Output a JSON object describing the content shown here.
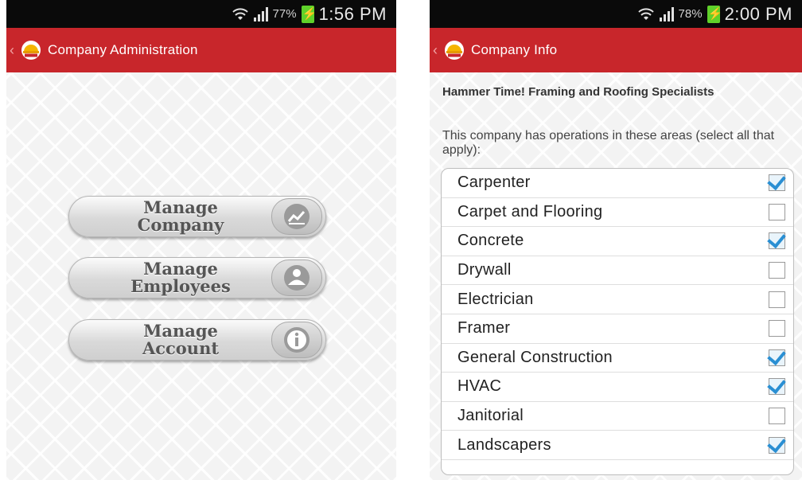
{
  "left": {
    "status": {
      "battery": "77%",
      "time": "1:56 PM"
    },
    "title": "Company Administration",
    "buttons": [
      {
        "line1": "Manage",
        "line2": "Company",
        "icon": "chart-icon"
      },
      {
        "line1": "Manage",
        "line2": "Employees",
        "icon": "people-icon"
      },
      {
        "line1": "Manage",
        "line2": "Account",
        "icon": "info-icon"
      }
    ]
  },
  "right": {
    "status": {
      "battery": "78%",
      "time": "2:00 PM"
    },
    "title": "Company Info",
    "company_name": "Hammer Time!  Framing and Roofing Specialists",
    "instructions": "This company has operations in these areas (select all that apply):",
    "items": [
      {
        "label": "Carpenter",
        "checked": true
      },
      {
        "label": "Carpet and Flooring",
        "checked": false
      },
      {
        "label": "Concrete",
        "checked": true
      },
      {
        "label": "Drywall",
        "checked": false
      },
      {
        "label": "Electrician",
        "checked": false
      },
      {
        "label": "Framer",
        "checked": false
      },
      {
        "label": "General Construction",
        "checked": true
      },
      {
        "label": "HVAC",
        "checked": true
      },
      {
        "label": "Janitorial",
        "checked": false
      },
      {
        "label": "Landscapers",
        "checked": true
      }
    ]
  },
  "colors": {
    "actionbar": "#c8262b",
    "checkmark": "#2a8fd3",
    "statusbar": "#0a0a0a"
  }
}
